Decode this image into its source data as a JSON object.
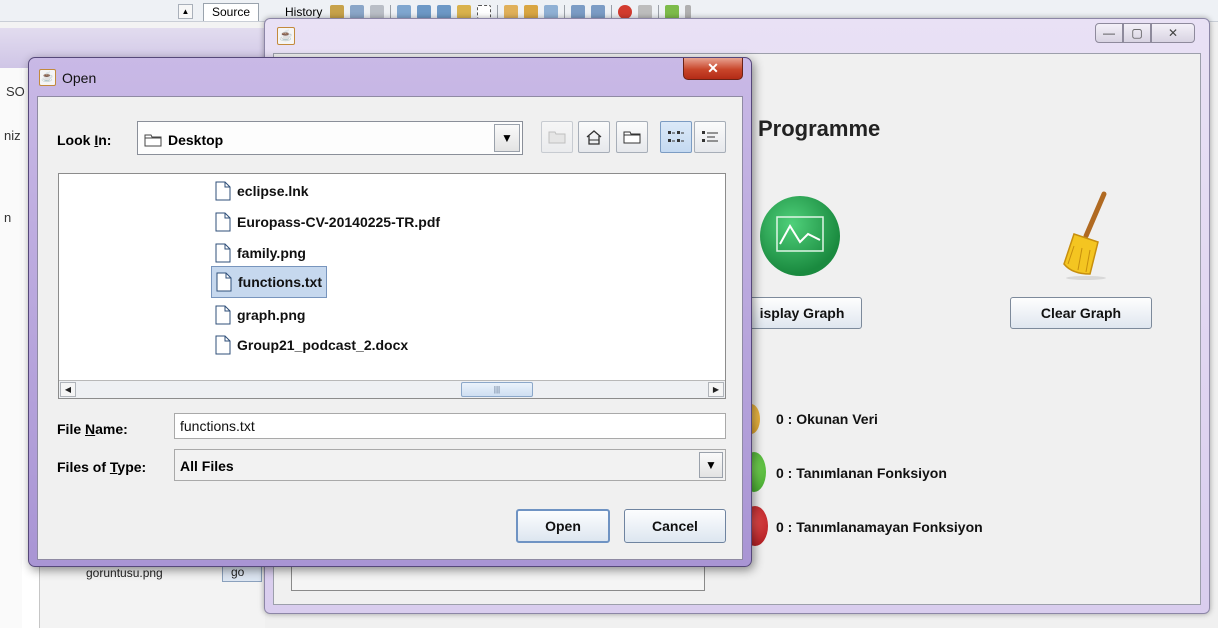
{
  "ide": {
    "tab_source": "Source",
    "tab_history": "History",
    "left_fragment_1": "SO",
    "left_fragment_2": "niz",
    "left_fragment_3": "n",
    "bottom_file_fragment": "goruntusu.png",
    "bottom_button_fragment": "go"
  },
  "app": {
    "heading_visible": "Programme",
    "display_graph_button": "isplay Graph",
    "clear_graph_button": "Clear Graph",
    "status": [
      {
        "label": "0 : Okunan Veri",
        "color": "#e0a126"
      },
      {
        "label": "0 : Tanımlanan Fonksiyon",
        "color": "#3fa52a"
      },
      {
        "label": "0 : Tanımlanamayan Fonksiyon",
        "color": "#c0191d"
      }
    ],
    "window_controls": {
      "minimize": "—",
      "maximize": "▢",
      "close": "✕"
    }
  },
  "dialog": {
    "title": "Open",
    "close_label": "✕",
    "look_in_prefix": "Look ",
    "look_in_underlined": "I",
    "look_in_suffix": "n:",
    "look_in_value": "Desktop",
    "files": [
      {
        "name": "eclipse.lnk",
        "selected": false
      },
      {
        "name": "Europass-CV-20140225-TR.pdf",
        "selected": false
      },
      {
        "name": "family.png",
        "selected": false
      },
      {
        "name": "functions.txt",
        "selected": true
      },
      {
        "name": "graph.png",
        "selected": false
      },
      {
        "name": "Group21_podcast_2.docx",
        "selected": false
      }
    ],
    "file_name_prefix": "File ",
    "file_name_underlined": "N",
    "file_name_suffix": "ame:",
    "file_name_value": "functions.txt",
    "files_of_type_prefix": "Files of ",
    "files_of_type_underlined": "T",
    "files_of_type_suffix": "ype:",
    "files_of_type_value": "All Files",
    "open_button": "Open",
    "cancel_button": "Cancel"
  }
}
